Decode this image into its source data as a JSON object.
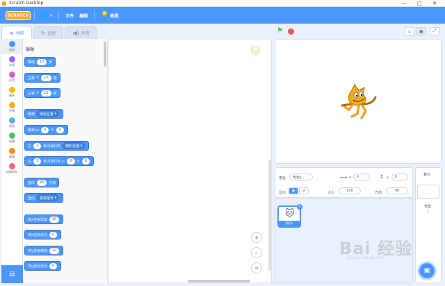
{
  "window": {
    "title": "Scratch Desktop",
    "min": "—",
    "max": "□",
    "close": "✕"
  },
  "menu": {
    "logo": "SCRATCH",
    "globe_icon": "globe-icon",
    "file": "文件",
    "edit": "编辑",
    "tutorials": "教程"
  },
  "tabs": [
    {
      "label": "代码"
    },
    {
      "label": "造型"
    },
    {
      "label": "声音"
    }
  ],
  "categories": [
    {
      "label": "运动",
      "color": "#4c97ff"
    },
    {
      "label": "外观",
      "color": "#9966ff"
    },
    {
      "label": "声音",
      "color": "#cf63cf"
    },
    {
      "label": "事件",
      "color": "#ffbf00"
    },
    {
      "label": "控制",
      "color": "#ffab19"
    },
    {
      "label": "侦测",
      "color": "#5cb1d6"
    },
    {
      "label": "运算",
      "color": "#59c059"
    },
    {
      "label": "变量",
      "color": "#ff8c1a"
    },
    {
      "label": "自制积木",
      "color": "#ff6680"
    }
  ],
  "palette": {
    "title": "运动",
    "b1": {
      "a": "移动",
      "v": "10",
      "b": "步"
    },
    "b2": {
      "a": "右转",
      "v": "15",
      "b": "度"
    },
    "b3": {
      "a": "左转",
      "v": "15",
      "b": "度"
    },
    "b4": {
      "a": "移到",
      "d": "随机位置"
    },
    "b5": {
      "a": "移到 x:",
      "v1": "0",
      "m": "y:",
      "v2": "0"
    },
    "b6": {
      "a": "在",
      "v": "1",
      "m": "秒内滑行到",
      "d": "随机位置"
    },
    "b7": {
      "a": "在",
      "v": "1",
      "m": "秒内滑行到 x:",
      "v1": "0",
      "n": "y:",
      "v2": "0"
    },
    "b8": {
      "a": "面向",
      "v": "90",
      "b": "方向"
    },
    "b9": {
      "a": "面向",
      "d": "鼠标指针"
    },
    "b10": {
      "a": "将x坐标增加",
      "v": "10"
    },
    "b11": {
      "a": "将x坐标设为",
      "v": "0"
    },
    "b12": {
      "a": "将y坐标增加",
      "v": "10"
    },
    "b13": {
      "a": "将y坐标设为",
      "v": "0"
    }
  },
  "zoom": {
    "in": "+",
    "out": "−",
    "reset": "="
  },
  "sprite_info": {
    "name_label": "角色",
    "name_value": "角色1",
    "x_label": "x",
    "x_value": "0",
    "y_label": "y",
    "y_value": "0",
    "show_label": "显示",
    "size_label": "大小",
    "size_value": "100",
    "direction_label": "方向",
    "direction_value": "90"
  },
  "sprite_list": [
    {
      "name": "角色1"
    }
  ],
  "stage_panel": {
    "title": "舞台",
    "backdrops_label": "背景",
    "backdrops_count": "1"
  },
  "watermark": {
    "main": "Bai 经验",
    "sub": "jingyan.baidu.com"
  }
}
